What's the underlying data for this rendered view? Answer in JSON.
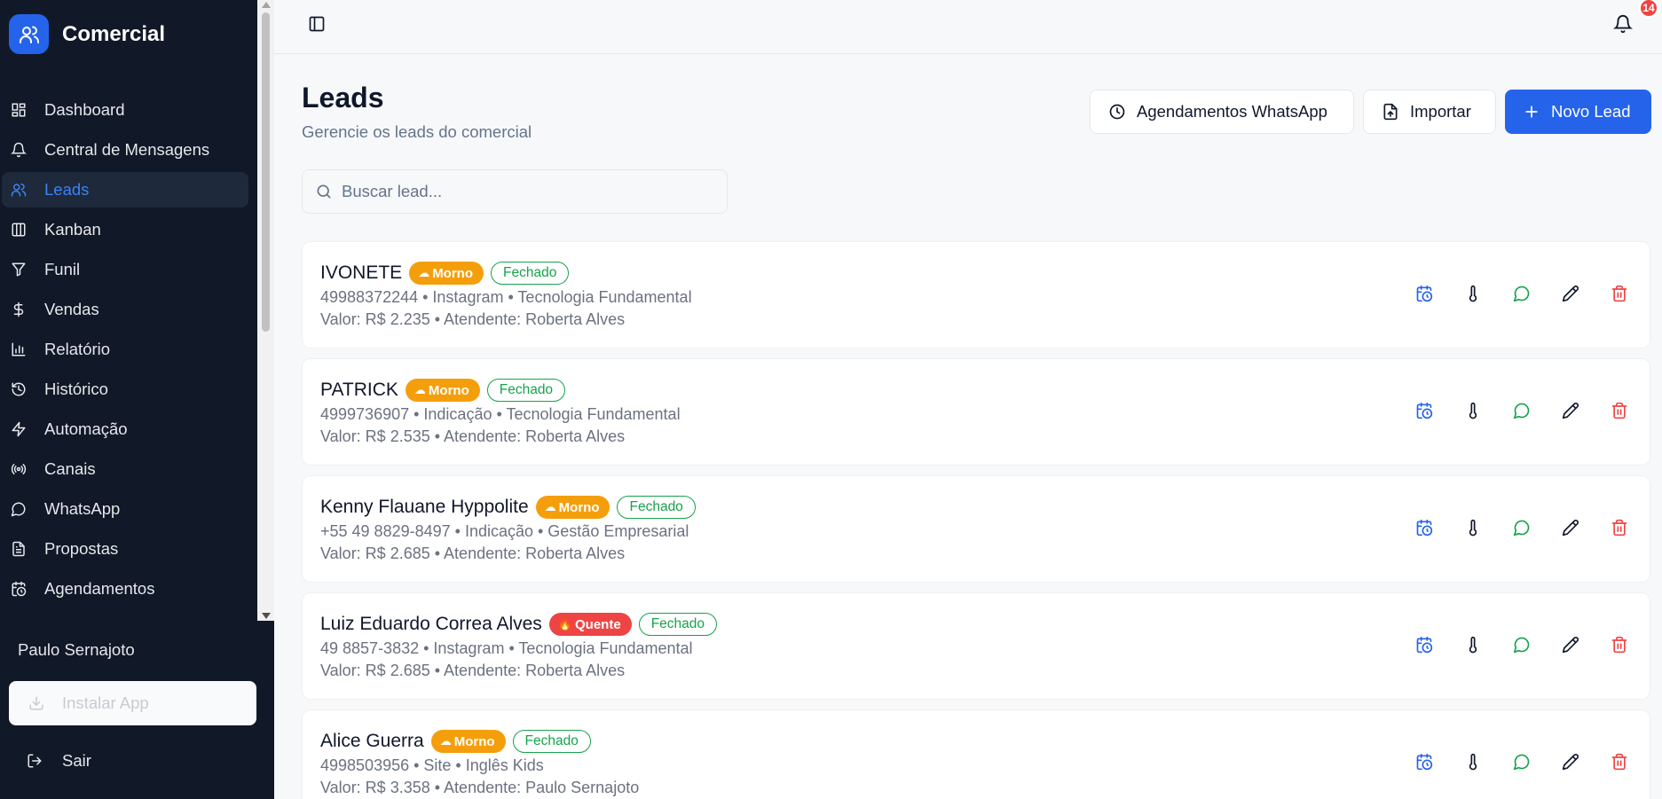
{
  "app": {
    "name": "Comercial"
  },
  "sidebar": {
    "items": [
      {
        "label": "Dashboard",
        "icon": "dashboard-icon",
        "active": false
      },
      {
        "label": "Central de Mensagens",
        "icon": "bell-icon",
        "active": false
      },
      {
        "label": "Leads",
        "icon": "users-icon",
        "active": true
      },
      {
        "label": "Kanban",
        "icon": "kanban-icon",
        "active": false
      },
      {
        "label": "Funil",
        "icon": "funnel-icon",
        "active": false
      },
      {
        "label": "Vendas",
        "icon": "dollar-icon",
        "active": false
      },
      {
        "label": "Relatório",
        "icon": "bar-chart-icon",
        "active": false
      },
      {
        "label": "Histórico",
        "icon": "history-icon",
        "active": false
      },
      {
        "label": "Automação",
        "icon": "lightning-icon",
        "active": false
      },
      {
        "label": "Canais",
        "icon": "broadcast-icon",
        "active": false
      },
      {
        "label": "WhatsApp",
        "icon": "chat-bubble-icon",
        "active": false
      },
      {
        "label": "Propostas",
        "icon": "document-icon",
        "active": false
      },
      {
        "label": "Agendamentos",
        "icon": "calendar-clock-icon",
        "active": false
      }
    ],
    "user_name": "Paulo Sernajoto",
    "install_label": "Instalar App",
    "logout_label": "Sair"
  },
  "topbar": {
    "notification_count": "14"
  },
  "header": {
    "title": "Leads",
    "subtitle": "Gerencie os leads do comercial",
    "buttons": {
      "schedules": "Agendamentos WhatsApp",
      "import": "Importar",
      "new_lead": "Novo Lead"
    }
  },
  "search": {
    "placeholder": "Buscar lead..."
  },
  "leads": [
    {
      "name": "IVONETE",
      "temperature": "Morno",
      "status": "Fechado",
      "details": "49988372244 • Instagram • Tecnologia Fundamental",
      "value_line": "Valor: R$ 2.235 • Atendente: Roberta Alves"
    },
    {
      "name": "PATRICK",
      "temperature": "Morno",
      "status": "Fechado",
      "details": "4999736907 • Indicação • Tecnologia Fundamental",
      "value_line": "Valor: R$ 2.535 • Atendente: Roberta Alves"
    },
    {
      "name": "Kenny Flauane Hyppolite",
      "temperature": "Morno",
      "status": "Fechado",
      "details": "+55 49 8829-8497 • Indicação • Gestão Empresarial",
      "value_line": "Valor: R$ 2.685 • Atendente: Roberta Alves"
    },
    {
      "name": "Luiz Eduardo Correa Alves",
      "temperature": "Quente",
      "status": "Fechado",
      "details": "49 8857-3832 • Instagram • Tecnologia Fundamental",
      "value_line": "Valor: R$ 2.685 • Atendente: Roberta Alves"
    },
    {
      "name": "Alice Guerra",
      "temperature": "Morno",
      "status": "Fechado",
      "details": "4998503956 • Site • Inglês Kids",
      "value_line": "Valor: R$ 3.358 • Atendente: Paulo Sernajoto"
    }
  ],
  "colors": {
    "sidebar_bg": "#111827",
    "accent": "#2563eb",
    "morno": "#f59e0b",
    "quente": "#ef4444",
    "status_green": "#16a34a",
    "delete_red": "#ef4444"
  }
}
